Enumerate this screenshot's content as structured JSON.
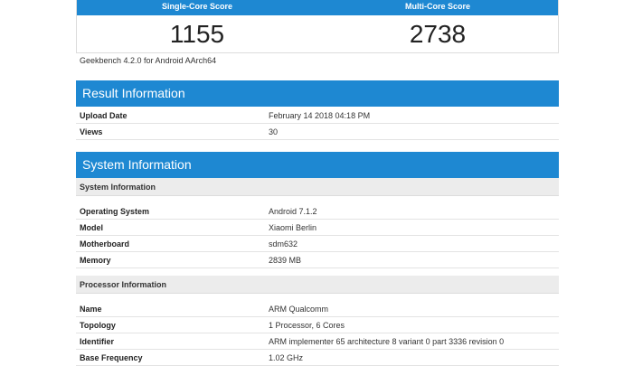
{
  "scores": {
    "single_core_label": "Single-Core Score",
    "multi_core_label": "Multi-Core Score",
    "single_core_value": "1155",
    "multi_core_value": "2738",
    "version": "Geekbench 4.2.0 for Android AArch64"
  },
  "result_information": {
    "title": "Result Information",
    "rows": [
      {
        "key": "Upload Date",
        "value": "February 14 2018 04:18 PM"
      },
      {
        "key": "Views",
        "value": "30"
      }
    ]
  },
  "system_information": {
    "title": "System Information",
    "system_subhead": "System Information",
    "system_rows": [
      {
        "key": "Operating System",
        "value": "Android 7.1.2"
      },
      {
        "key": "Model",
        "value": "Xiaomi Berlin"
      },
      {
        "key": "Motherboard",
        "value": "sdm632"
      },
      {
        "key": "Memory",
        "value": "2839 MB"
      }
    ],
    "processor_subhead": "Processor Information",
    "processor_rows": [
      {
        "key": "Name",
        "value": "ARM Qualcomm"
      },
      {
        "key": "Topology",
        "value": "1 Processor, 6 Cores"
      },
      {
        "key": "Identifier",
        "value": "ARM implementer 65 architecture 8 variant 0 part 3336 revision 0"
      },
      {
        "key": "Base Frequency",
        "value": "1.02 GHz"
      }
    ]
  },
  "colors": {
    "accent_blue": "#1e88d2",
    "subhead_gray": "#ececec"
  }
}
